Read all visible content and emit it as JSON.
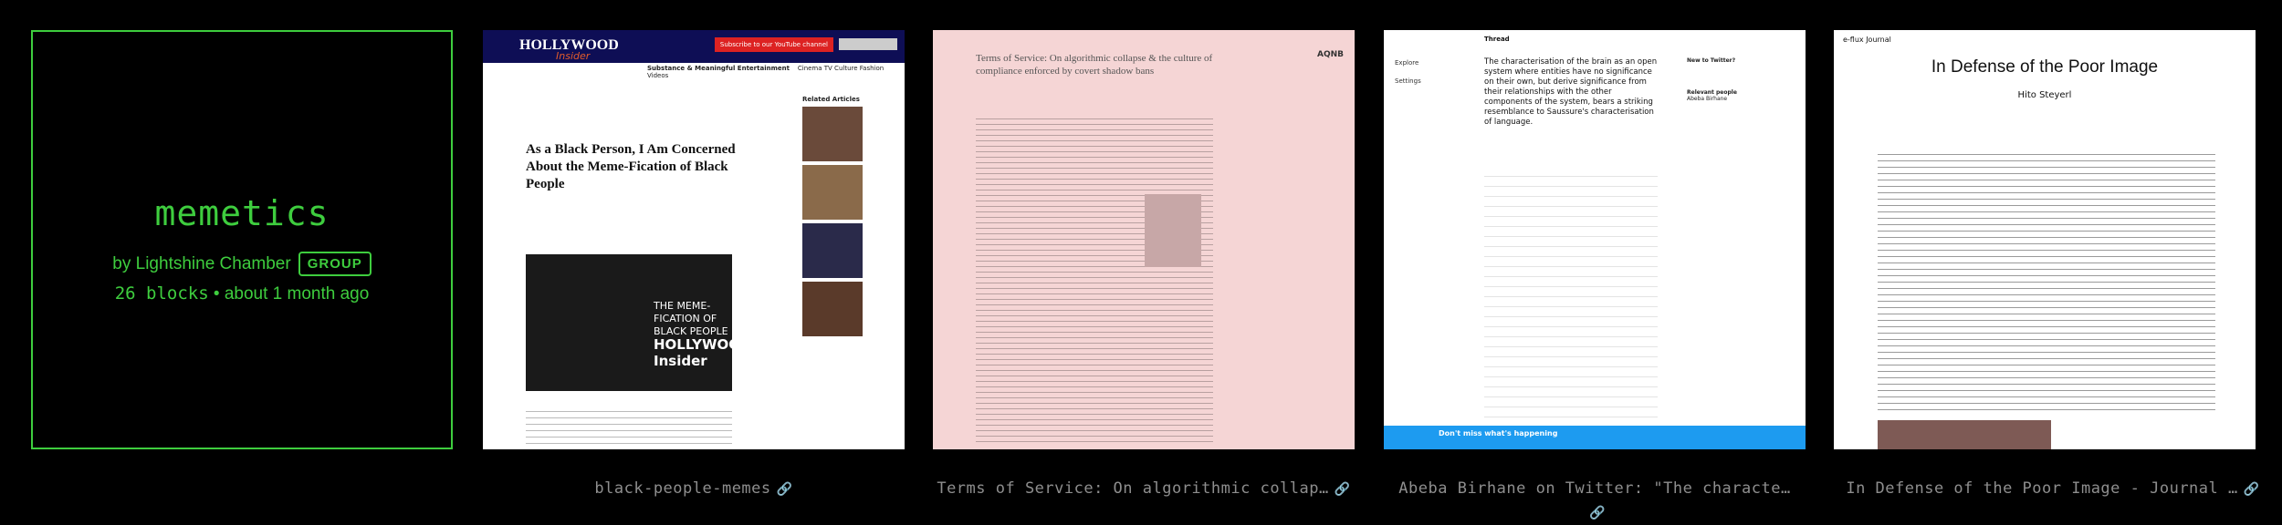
{
  "channel": {
    "title": "memetics",
    "by": "by Lightshine Chamber",
    "badge": "GROUP",
    "blocks": "26 blocks",
    "updated": "• about 1 month ago"
  },
  "blocks": [
    {
      "caption": "black-people-memes",
      "preview": {
        "logo": "HOLLYWOOD",
        "logo_sub": "Insider",
        "subscribe": "Subscribe to our YouTube channel",
        "tagline": "Substance & Meaningful Entertainment",
        "nav": "Cinema   TV   Culture   Fashion   Videos",
        "headline": "As a Black Person, I Am Concerned About the Meme-Fication of Black People",
        "video_title": "THE MEME-FICATION OF BLACK PEOPLE",
        "video_brand": "HOLLYWOOD Insider",
        "related": "Related Articles"
      }
    },
    {
      "caption": "Terms of Service: On algorithmic collap…",
      "preview": {
        "title": "Terms of Service: On algorithmic collapse & the culture of compliance enforced by covert shadow bans",
        "logo": "AQNB"
      }
    },
    {
      "caption": "Abeba Birhane on Twitter: \"The characte…",
      "preview": {
        "thread": "Thread",
        "menu": [
          "Explore",
          "Settings"
        ],
        "tweet": "The characterisation of the brain as an open system where entities have no significance on their own, but derive significance from their relationships with the other components of the system, bears a striking resemblance to Saussure's characterisation of language.",
        "new_to_twitter": "New to Twitter?",
        "relevant": "Relevant people",
        "person": "Abeba Birhane",
        "banner": "Don't miss what's happening"
      }
    },
    {
      "caption": "In Defense of the Poor Image - Journal …",
      "preview": {
        "journal": "e-flux Journal",
        "title": "In Defense of the Poor Image",
        "author": "Hito Steyerl"
      }
    }
  ],
  "link_icon": "link-icon",
  "colors": {
    "accent": "#3ecd3e",
    "caption": "#8e8e8e",
    "background": "#000000"
  }
}
